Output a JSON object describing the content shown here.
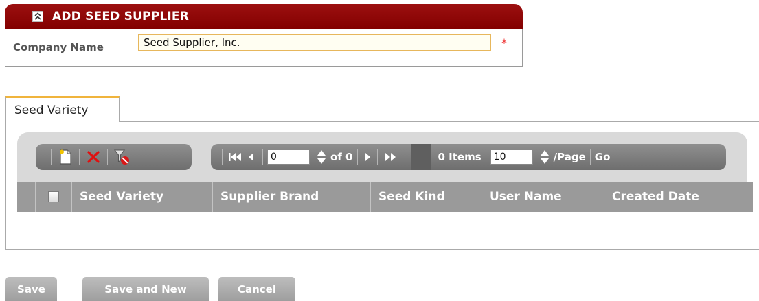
{
  "form": {
    "title": "ADD SEED SUPPLIER",
    "company_label": "Company Name",
    "company_value": "Seed Supplier, Inc.",
    "required_mark": "*"
  },
  "tab": {
    "label": "Seed Variety"
  },
  "toolbar": {
    "icons": [
      "new-record-icon",
      "delete-icon",
      "clear-filter-icon"
    ]
  },
  "pager": {
    "page_value": "0",
    "of_text": "of 0",
    "items_text": "0 Items",
    "page_size_value": "10",
    "per_page_text": "/Page",
    "go_label": "Go"
  },
  "grid": {
    "columns": [
      "Seed Variety",
      "Supplier Brand",
      "Seed Kind",
      "User Name",
      "Created Date"
    ]
  },
  "actions": {
    "save": "Save",
    "save_new": "Save and New",
    "cancel": "Cancel"
  },
  "colors": {
    "header_red": "#8b0000",
    "accent_orange": "#f0b43c",
    "required_red": "#ee3333",
    "grid_gray": "#9a9a9a"
  }
}
